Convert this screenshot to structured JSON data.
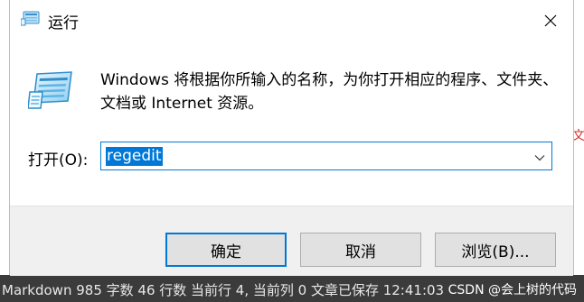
{
  "window": {
    "title": "运行",
    "close_glyph": "✕"
  },
  "dialog": {
    "description": "Windows 将根据你所输入的名称，为你打开相应的程序、文件夹、文档或 Internet 资源。",
    "open_label": "打开(O):",
    "open_value": "regedit",
    "icons": {
      "title": "run-program-icon",
      "main": "run-program-icon",
      "dropdown": "chevron-down-icon"
    }
  },
  "buttons": {
    "ok": "确定",
    "cancel": "取消",
    "browse": "浏览(B)..."
  },
  "background": {
    "strip_text": "Markdown  985 字数  46 行数  当前行 4, 当前列 0  文章已保存 12:41:03",
    "watermark": "CSDN @会上树的代码",
    "red_mark": "文"
  },
  "colors": {
    "accent": "#0078d7",
    "footer_bg": "#f0f0f0",
    "button_bg": "#e1e1e1"
  }
}
